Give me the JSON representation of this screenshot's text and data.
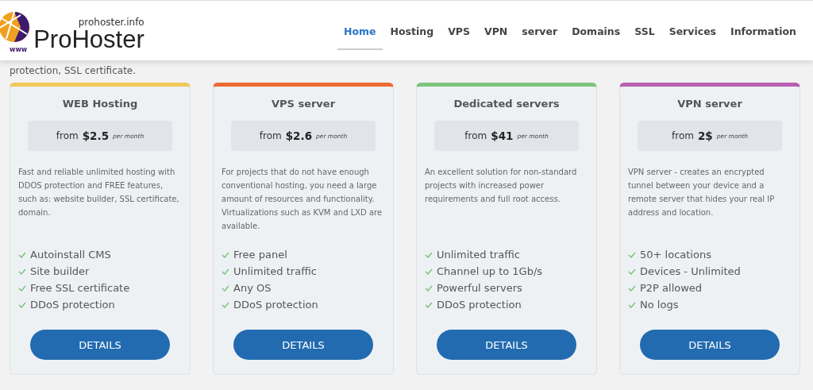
{
  "logo": {
    "domain": "prohoster.info",
    "name": "ProHoster",
    "www": "www"
  },
  "nav": [
    {
      "label": "Home",
      "selected": true
    },
    {
      "label": "Hosting",
      "selected": false
    },
    {
      "label": "VPS",
      "selected": false
    },
    {
      "label": "VPN",
      "selected": false
    },
    {
      "label": "server",
      "selected": false
    },
    {
      "label": "Domains",
      "selected": false
    },
    {
      "label": "SSL",
      "selected": false
    },
    {
      "label": "Services",
      "selected": false
    },
    {
      "label": "Information",
      "selected": false
    }
  ],
  "intro_fragment": "protection, SSL certificate.",
  "plans": [
    {
      "title": "WEB Hosting",
      "color": "#f0c85a",
      "price_prefix": "from",
      "price": "$2.5",
      "period": "per month",
      "description": "Fast and reliable unlimited hosting with DDOS protection and FREE features, such as: website builder, SSL certificate, domain.",
      "features": [
        "Autoinstall CMS",
        "Site builder",
        "Free SSL certificate",
        "DDoS protection"
      ],
      "button": "DETAILS"
    },
    {
      "title": "VPS server",
      "color": "#ef6a35",
      "price_prefix": "from",
      "price": "$2.6",
      "period": "per month",
      "description": "For projects that do not have enough conventional hosting, you need a large amount of resources and functionality. Virtualizations such as KVM and LXD are available.",
      "features": [
        "Free panel",
        "Unlimited traffic",
        "Any OS",
        "DDoS protection"
      ],
      "button": "DETAILS"
    },
    {
      "title": "Dedicated servers",
      "color": "#7cc47f",
      "price_prefix": "from",
      "price": "$41",
      "period": "per month",
      "description": "An excellent solution for non-standard projects with increased power requirements and full root access.",
      "features": [
        "Unlimited traffic",
        "Channel up to 1Gb/s",
        "Powerful servers",
        "DDoS protection"
      ],
      "button": "DETAILS"
    },
    {
      "title": "VPN server",
      "color": "#b85fb0",
      "price_prefix": "from",
      "price": "2$",
      "period": "per month",
      "description": "VPN server - creates an encrypted tunnel between your device and a remote server that hides your real IP address and location.",
      "features": [
        "50+ locations",
        "Devices - Unlimited",
        "P2P allowed",
        "No logs"
      ],
      "button": "DETAILS"
    }
  ]
}
